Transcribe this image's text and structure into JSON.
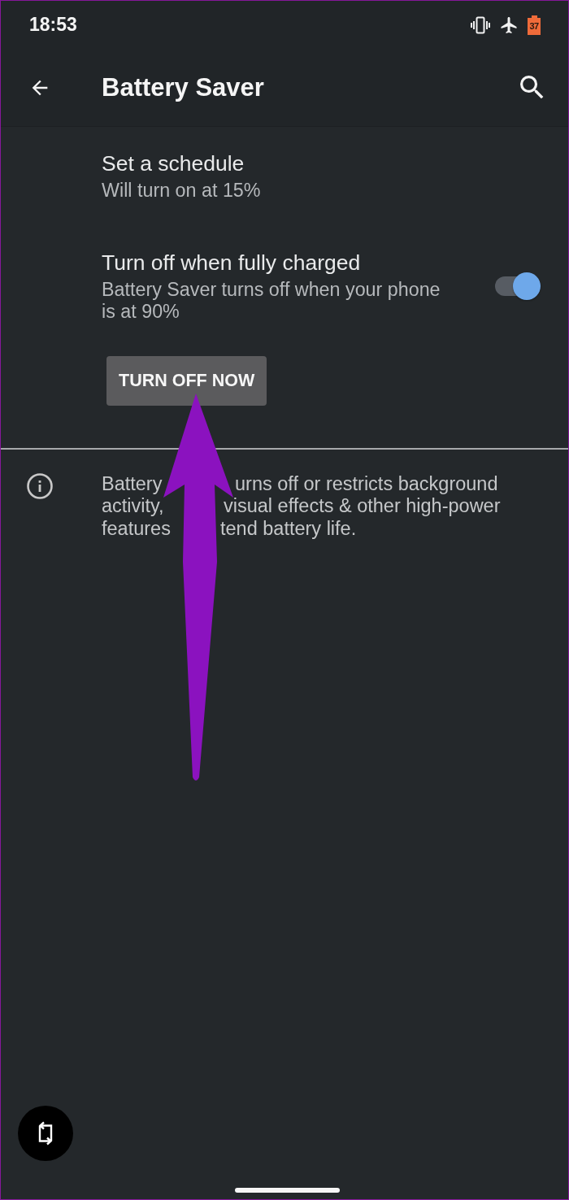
{
  "status_bar": {
    "time": "18:53",
    "battery_level": "37",
    "battery_saver": true
  },
  "app_bar": {
    "title": "Battery Saver"
  },
  "settings": [
    {
      "kind": "link",
      "title": "Set a schedule",
      "summary": "Will turn on at 15%"
    },
    {
      "kind": "toggle",
      "title": "Turn off when fully charged",
      "summary": "Battery Saver turns off when your phone is at 90%",
      "on": true
    }
  ],
  "action_button": {
    "label": "TURN OFF NOW"
  },
  "footer": {
    "lines": [
      {
        "left": "Battery",
        "right": "urns off or restricts background"
      },
      {
        "left": "activity,",
        "right": "visual effects & other high-power"
      },
      {
        "left": "features",
        "right": "tend battery life."
      }
    ]
  }
}
